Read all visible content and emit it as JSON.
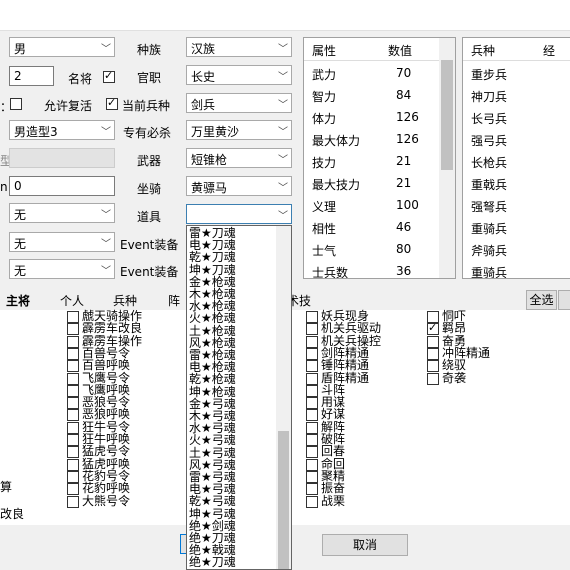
{
  "left_controls": {
    "gender": "男",
    "number_value": "2",
    "famous_label": "名将",
    "famous_checked": true,
    "revive_label": "允许复活",
    "revive_checked": false,
    "current_troop_label": "当前兵种",
    "current_troop_checked": true,
    "model": "男造型3",
    "blank_input": "0",
    "item1": "无",
    "item2": "无",
    "item3": "无",
    "partial_label_a": "：",
    "partial_label_b": "型",
    "partial_label_c": "n"
  },
  "mid_controls": {
    "race_label": "种族",
    "race_value": "汉族",
    "rank_label": "官职",
    "rank_value": "长史",
    "troop_label": "当前兵种",
    "troop_value": "剑兵",
    "special_label": "专有必杀",
    "special_value": "万里黄沙",
    "weapon_label": "武器",
    "weapon_value": "短锥枪",
    "mount_label": "坐骑",
    "mount_value": "黄骠马",
    "tool_label": "道具",
    "tool_value": "",
    "event1_label": "Event装备",
    "event2_label": "Event装备"
  },
  "attr_table": {
    "headers": [
      "属性",
      "数值"
    ],
    "rows": [
      [
        "武力",
        "70"
      ],
      [
        "智力",
        "84"
      ],
      [
        "体力",
        "126"
      ],
      [
        "最大体力",
        "126"
      ],
      [
        "技力",
        "21"
      ],
      [
        "最大技力",
        "21"
      ],
      [
        "义理",
        "100"
      ],
      [
        "相性",
        "46"
      ],
      [
        "士气",
        "80"
      ],
      [
        "士兵数",
        "36"
      ]
    ]
  },
  "troop_table": {
    "headers": [
      "兵种",
      "经"
    ],
    "rows": [
      "重步兵",
      "神刀兵",
      "长弓兵",
      "强弓兵",
      "长枪兵",
      "重戟兵",
      "强弩兵",
      "重骑兵",
      "斧骑兵",
      "重骑兵"
    ]
  },
  "tabs": [
    "主将",
    "个人",
    "兵种",
    "阵",
    "术技"
  ],
  "select_all_label": "全选",
  "side_labels": [
    "算",
    "改良"
  ],
  "skills_col1": [
    "虤天骑操作",
    "霹雳车改良",
    "霹雳车操作",
    "百兽号令",
    "百兽呼唤",
    "飞鹰号令",
    "飞鹰呼唤",
    "恶狼号令",
    "恶狼呼唤",
    "狂牛号令",
    "狂牛呼唤",
    "猛虎号令",
    "猛虎呼唤",
    "花豹号令",
    "花豹呼唤",
    "大熊号令"
  ],
  "skills_col2": [
    "妖兵现身",
    "机关兵驱动",
    "机关兵操控",
    "剑阵精通",
    "锤阵精通",
    "盾阵精通",
    "斗阵",
    "用谋",
    "好谋",
    "解阵",
    "破阵",
    "回春",
    "命回",
    "聚精",
    "振奋",
    "战栗"
  ],
  "skills_col3": [
    "恫吓",
    "羁昂",
    "奋勇",
    "冲阵精通",
    "绕驭",
    "奇袭"
  ],
  "skills_col3_checked": [
    false,
    true,
    false,
    false,
    false,
    false
  ],
  "cancel_label": "取消",
  "dropdown_items": [
    "雷★刀魂",
    "电★刀魂",
    "乾★刀魂",
    "坤★刀魂",
    "金★枪魂",
    "木★枪魂",
    "水★枪魂",
    "火★枪魂",
    "土★枪魂",
    "风★枪魂",
    "雷★枪魂",
    "电★枪魂",
    "乾★枪魂",
    "坤★枪魂",
    "金★弓魂",
    "木★弓魂",
    "水★弓魂",
    "火★弓魂",
    "土★弓魂",
    "风★弓魂",
    "雷★弓魂",
    "电★弓魂",
    "乾★弓魂",
    "坤★弓魂",
    "绝★剑魂",
    "绝★刀魂",
    "绝★戟魂",
    "绝★刀魂"
  ]
}
